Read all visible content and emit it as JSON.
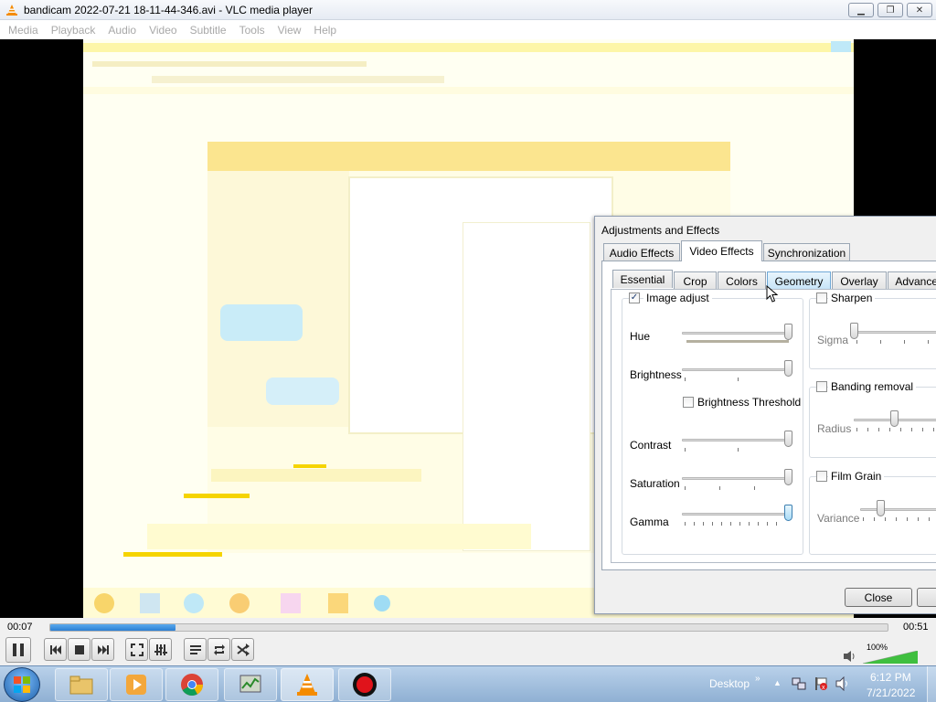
{
  "window": {
    "title": "bandicam 2022-07-21 18-11-44-346.avi - VLC media player",
    "buttons": [
      "minimize",
      "restore",
      "close"
    ]
  },
  "menu": [
    "Media",
    "Playback",
    "Audio",
    "Video",
    "Subtitle",
    "Tools",
    "View",
    "Help"
  ],
  "dialog": {
    "title": "Adjustments and Effects",
    "main_tabs": [
      {
        "label": "Audio Effects",
        "active": false
      },
      {
        "label": "Video Effects",
        "active": true
      },
      {
        "label": "Synchronization",
        "active": false
      }
    ],
    "sub_tabs": [
      {
        "label": "Essential",
        "active": true
      },
      {
        "label": "Crop",
        "active": false
      },
      {
        "label": "Colors",
        "active": false
      },
      {
        "label": "Geometry",
        "active": false
      },
      {
        "label": "Overlay",
        "active": false
      },
      {
        "label": "Advanced",
        "active": false
      }
    ],
    "image_adjust": {
      "label": "Image adjust",
      "checked": true,
      "sliders": [
        {
          "label": "Hue",
          "level": 1.0
        },
        {
          "label": "Brightness",
          "level": 1.0
        },
        {
          "label": "Contrast",
          "level": 1.0
        },
        {
          "label": "Saturation",
          "level": 1.0
        },
        {
          "label": "Gamma",
          "level": 1.0
        }
      ],
      "brightness_threshold": {
        "label": "Brightness Threshold",
        "checked": false
      }
    },
    "sharpen": {
      "label": "Sharpen",
      "checked": false,
      "param": "Sigma",
      "level": 0.0
    },
    "banding": {
      "label": "Banding removal",
      "checked": false,
      "param": "Radius",
      "level": 0.3
    },
    "film_grain": {
      "label": "Film Grain",
      "checked": false,
      "param": "Variance",
      "level": 0.2
    },
    "close_label": "Close"
  },
  "player": {
    "time_elapsed": "00:07",
    "time_total": "00:51",
    "progress": 0.15,
    "volume_label": "100%",
    "volume_level": 1.0
  },
  "taskbar": {
    "desktop_label": "Desktop",
    "time": "6:12 PM",
    "date": "7/21/2022",
    "apps": [
      "windows-explorer",
      "media-player",
      "chrome",
      "task-manager",
      "vlc",
      "bandicam"
    ]
  }
}
